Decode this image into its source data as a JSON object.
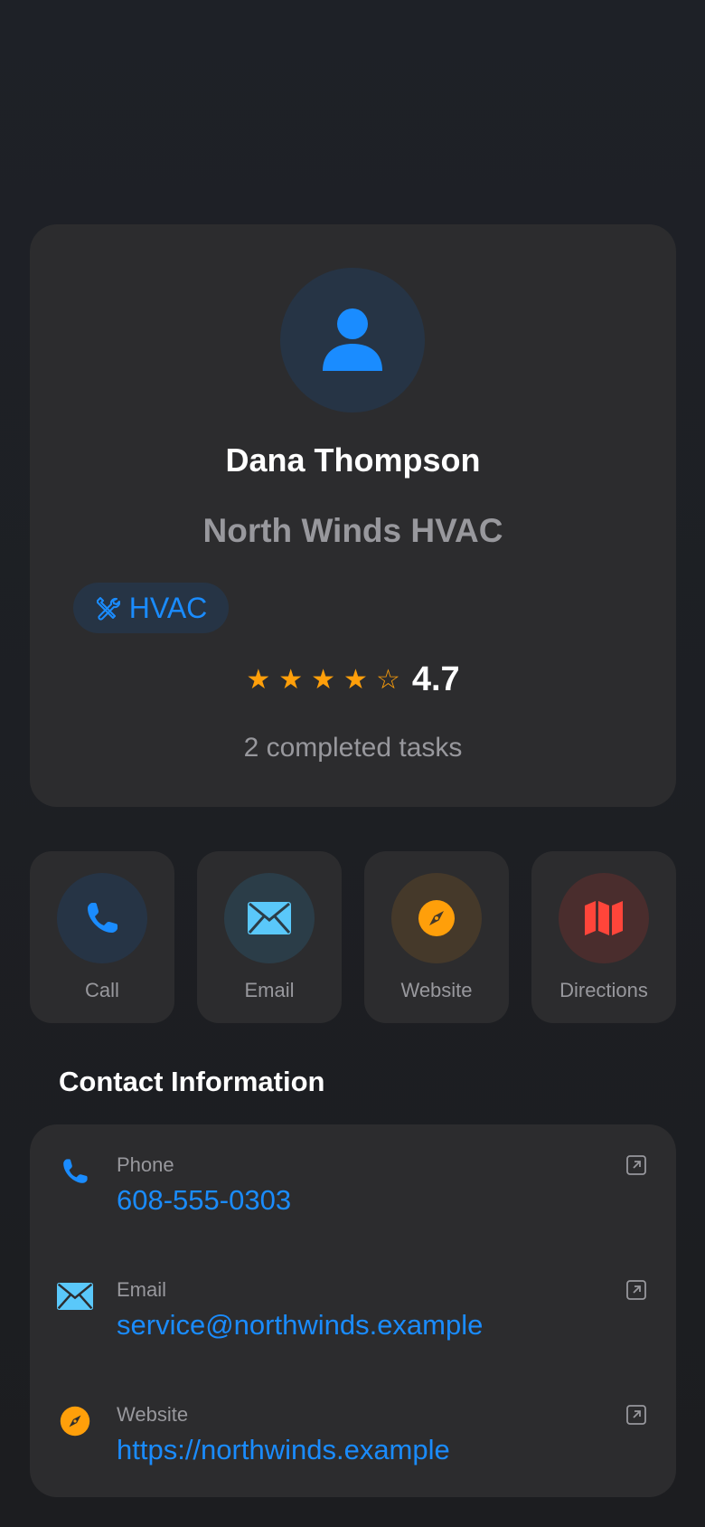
{
  "profile": {
    "name": "Dana Thompson",
    "company": "North Winds HVAC",
    "tag": "HVAC",
    "rating": 4.7,
    "rating_text": "4.7",
    "stars": [
      "★",
      "★",
      "★",
      "★",
      "☆"
    ],
    "tasks": "2 completed tasks"
  },
  "actions": [
    {
      "label": "Call",
      "icon": "phone-icon",
      "color": "#1a8cff"
    },
    {
      "label": "Email",
      "icon": "envelope-icon",
      "color": "#5ac8fa"
    },
    {
      "label": "Website",
      "icon": "compass-icon",
      "color": "#ff9f0a"
    },
    {
      "label": "Directions",
      "icon": "map-icon",
      "color": "#ff453a"
    }
  ],
  "contact": {
    "title": "Contact Information",
    "rows": [
      {
        "label": "Phone",
        "value": "608-555-0303",
        "icon": "phone-icon"
      },
      {
        "label": "Email",
        "value": "service@northwinds.example",
        "icon": "envelope-icon"
      },
      {
        "label": "Website",
        "value": "https://northwinds.example",
        "icon": "compass-icon"
      }
    ]
  },
  "colors": {
    "accent": "#1a8cff",
    "star": "#ff9f0a",
    "card": "#2c2c2e",
    "secondary_text": "#98989d"
  }
}
